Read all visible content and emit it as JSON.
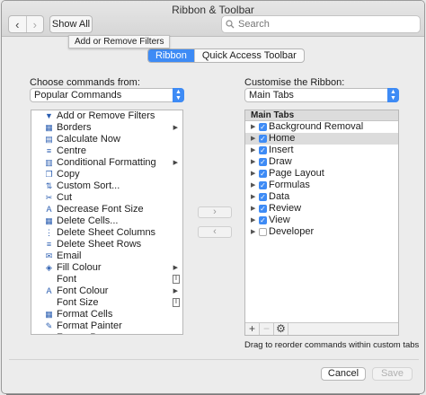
{
  "window": {
    "title": "Ribbon & Toolbar"
  },
  "toolbar": {
    "back": "‹",
    "forward": "›",
    "show_all": "Show All",
    "search_placeholder": "Search"
  },
  "tooltip": "Add or Remove Filters",
  "tabs": [
    {
      "label": "Ribbon",
      "active": true
    },
    {
      "label": "Quick Access Toolbar",
      "active": false
    }
  ],
  "left": {
    "label": "Choose commands from:",
    "dropdown_value": "Popular Commands",
    "commands": [
      {
        "label": "Add or Remove Filters",
        "icon": "filter-icon",
        "glyph": "▼"
      },
      {
        "label": "Borders",
        "icon": "borders-icon",
        "glyph": "▦",
        "submenu": true
      },
      {
        "label": "Calculate Now",
        "icon": "calculator-icon",
        "glyph": "▤"
      },
      {
        "label": "Centre",
        "icon": "align-center-icon",
        "glyph": "≡"
      },
      {
        "label": "Conditional Formatting",
        "icon": "conditional-formatting-icon",
        "glyph": "▥",
        "submenu": true
      },
      {
        "label": "Copy",
        "icon": "copy-icon",
        "glyph": "❐"
      },
      {
        "label": "Custom Sort...",
        "icon": "sort-icon",
        "glyph": "⇅"
      },
      {
        "label": "Cut",
        "icon": "scissors-icon",
        "glyph": "✂"
      },
      {
        "label": "Decrease Font Size",
        "icon": "decrease-font-icon",
        "glyph": "A"
      },
      {
        "label": "Delete Cells...",
        "icon": "delete-cells-icon",
        "glyph": "▦"
      },
      {
        "label": "Delete Sheet Columns",
        "icon": "delete-columns-icon",
        "glyph": "⋮"
      },
      {
        "label": "Delete Sheet Rows",
        "icon": "delete-rows-icon",
        "glyph": "≡"
      },
      {
        "label": "Email",
        "icon": "email-icon",
        "glyph": "✉"
      },
      {
        "label": "Fill Colour",
        "icon": "fill-colour-icon",
        "glyph": "◈",
        "submenu": true
      },
      {
        "label": "Font",
        "icon": "",
        "glyph": "",
        "format": true
      },
      {
        "label": "Font Colour",
        "icon": "font-colour-icon",
        "glyph": "A",
        "submenu": true
      },
      {
        "label": "Font Size",
        "icon": "",
        "glyph": "",
        "format": true
      },
      {
        "label": "Format Cells",
        "icon": "format-cells-icon",
        "glyph": "▦"
      },
      {
        "label": "Format Painter",
        "icon": "format-painter-icon",
        "glyph": "✎"
      },
      {
        "label": "Freeze Panes",
        "icon": "freeze-panes-icon",
        "glyph": "▦"
      }
    ]
  },
  "right": {
    "label": "Customise the Ribbon:",
    "dropdown_value": "Main Tabs",
    "tree_header": "Main Tabs",
    "tabs": [
      {
        "label": "Background Removal",
        "checked": true
      },
      {
        "label": "Home",
        "checked": true,
        "selected": true
      },
      {
        "label": "Insert",
        "checked": true
      },
      {
        "label": "Draw",
        "checked": true
      },
      {
        "label": "Page Layout",
        "checked": true
      },
      {
        "label": "Formulas",
        "checked": true
      },
      {
        "label": "Data",
        "checked": true
      },
      {
        "label": "Review",
        "checked": true
      },
      {
        "label": "View",
        "checked": true
      },
      {
        "label": "Developer",
        "checked": false
      }
    ],
    "footer": {
      "add": "+",
      "remove": "−",
      "settings": "⚙"
    },
    "hint": "Drag to reorder commands within custom tabs"
  },
  "middle": {
    "add": "›",
    "remove": "‹"
  },
  "buttons": {
    "cancel": "Cancel",
    "save": "Save"
  }
}
